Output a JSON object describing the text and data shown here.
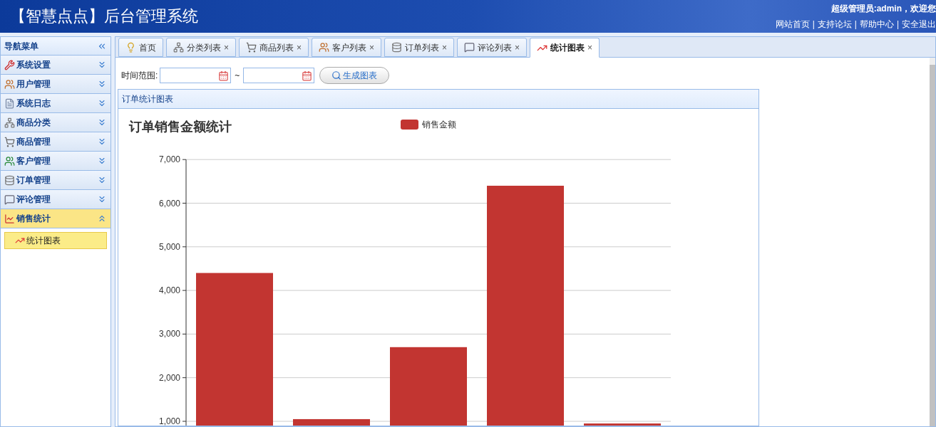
{
  "header": {
    "title": "【智慧点点】后台管理系统",
    "greeting": "超级管理员:admin，欢迎您",
    "separator": "|",
    "links": [
      "网站首页",
      "支持论坛",
      "帮助中心",
      "安全退出"
    ]
  },
  "sidebar": {
    "title": "导航菜单",
    "items": [
      {
        "label": "系统设置",
        "expanded": false
      },
      {
        "label": "用户管理",
        "expanded": false
      },
      {
        "label": "系统日志",
        "expanded": false
      },
      {
        "label": "商品分类",
        "expanded": false
      },
      {
        "label": "商品管理",
        "expanded": false
      },
      {
        "label": "客户管理",
        "expanded": false
      },
      {
        "label": "订单管理",
        "expanded": false
      },
      {
        "label": "评论管理",
        "expanded": false
      },
      {
        "label": "销售统计",
        "expanded": true,
        "children": [
          {
            "label": "统计图表",
            "selected": true
          }
        ]
      }
    ]
  },
  "tabs": [
    {
      "label": "首页",
      "selected": false
    },
    {
      "label": "分类列表",
      "close": "×",
      "selected": false
    },
    {
      "label": "商品列表",
      "close": "×",
      "selected": false
    },
    {
      "label": "客户列表",
      "close": "×",
      "selected": false
    },
    {
      "label": "订单列表",
      "close": "×",
      "selected": false
    },
    {
      "label": "评论列表",
      "close": "×",
      "selected": false
    },
    {
      "label": "统计图表",
      "close": "×",
      "selected": true
    }
  ],
  "toolbar": {
    "range_label": "时间范围:",
    "range_sep": "~",
    "button": "生成图表"
  },
  "panel": {
    "title": "订单统计图表",
    "chart_data": {
      "type": "bar",
      "grid": true,
      "title": "订单销售金额统计",
      "ylim": [
        0,
        7000
      ],
      "yticks": [
        {
          "value": 1000,
          "label": "1,000"
        },
        {
          "value": 2000,
          "label": "2,000"
        },
        {
          "value": 3000,
          "label": "3,000"
        },
        {
          "value": 4000,
          "label": "4,000"
        },
        {
          "value": 5000,
          "label": "5,000"
        },
        {
          "value": 6000,
          "label": "6,000"
        },
        {
          "value": 7000,
          "label": "7,000"
        }
      ],
      "series": [
        {
          "name": "销售金额",
          "color": "#c23531",
          "values": [
            4400,
            1050,
            2700,
            6400,
            950
          ]
        }
      ]
    }
  }
}
